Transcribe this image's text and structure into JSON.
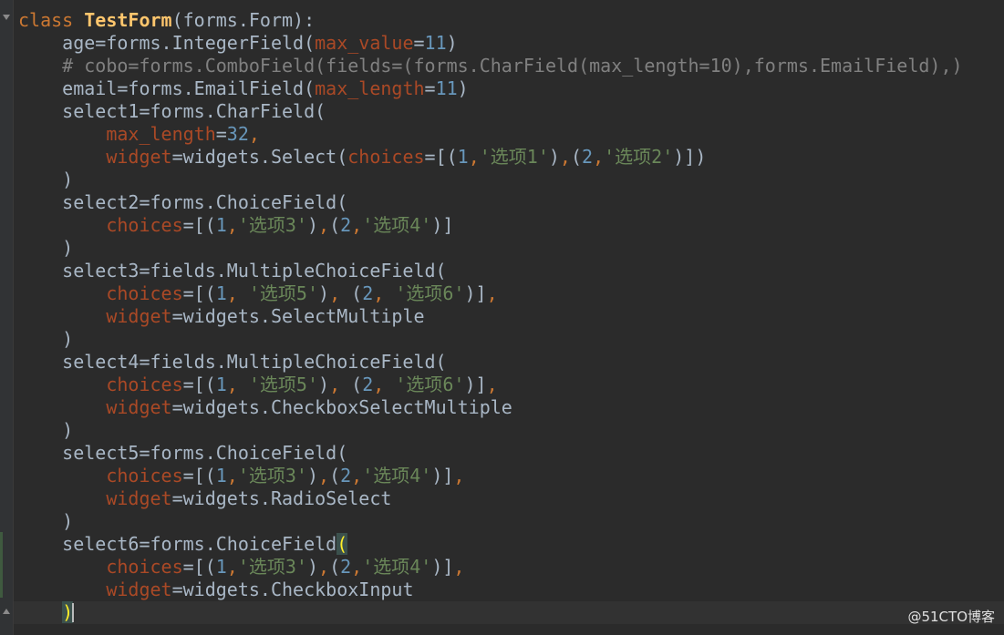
{
  "colors": {
    "background": "#2b2b2b",
    "keyword": "#cc7832",
    "class_name": "#ffc66d",
    "parameter": "#aa4926",
    "number": "#6897bb",
    "string": "#6a8759",
    "comment": "#808080",
    "text": "#a9b7c6"
  },
  "lines": [
    [
      {
        "t": "kw",
        "v": "class"
      },
      {
        "t": "tx",
        "v": " "
      },
      {
        "t": "cls",
        "v": "TestForm"
      },
      {
        "t": "tx",
        "v": "(forms.Form):"
      }
    ],
    [
      {
        "t": "tx",
        "v": "    age=forms.IntegerField("
      },
      {
        "t": "pr",
        "v": "max_value"
      },
      {
        "t": "tx",
        "v": "="
      },
      {
        "t": "nm",
        "v": "11"
      },
      {
        "t": "tx",
        "v": ")"
      }
    ],
    [
      {
        "t": "cm",
        "v": "    # cobo=forms.ComboField(fields=(forms.CharField(max_length=10),forms.EmailField),)"
      }
    ],
    [
      {
        "t": "tx",
        "v": "    email=forms.EmailField("
      },
      {
        "t": "pr",
        "v": "max_length"
      },
      {
        "t": "tx",
        "v": "="
      },
      {
        "t": "nm",
        "v": "11"
      },
      {
        "t": "tx",
        "v": ")"
      }
    ],
    [
      {
        "t": "tx",
        "v": "    select1=forms.CharField("
      }
    ],
    [
      {
        "t": "tx",
        "v": "        "
      },
      {
        "t": "pr",
        "v": "max_length"
      },
      {
        "t": "tx",
        "v": "="
      },
      {
        "t": "nm",
        "v": "32"
      },
      {
        "t": "pu",
        "v": ","
      }
    ],
    [
      {
        "t": "tx",
        "v": "        "
      },
      {
        "t": "pr",
        "v": "widget"
      },
      {
        "t": "tx",
        "v": "=widgets.Select("
      },
      {
        "t": "pr",
        "v": "choices"
      },
      {
        "t": "tx",
        "v": "=[("
      },
      {
        "t": "nm",
        "v": "1"
      },
      {
        "t": "pu",
        "v": ","
      },
      {
        "t": "st",
        "v": "'选项1'"
      },
      {
        "t": "tx",
        "v": ")"
      },
      {
        "t": "pu",
        "v": ","
      },
      {
        "t": "tx",
        "v": "("
      },
      {
        "t": "nm",
        "v": "2"
      },
      {
        "t": "pu",
        "v": ","
      },
      {
        "t": "st",
        "v": "'选项2'"
      },
      {
        "t": "tx",
        "v": ")])"
      }
    ],
    [
      {
        "t": "tx",
        "v": "    )"
      }
    ],
    [
      {
        "t": "tx",
        "v": "    select2=forms.ChoiceField("
      }
    ],
    [
      {
        "t": "tx",
        "v": "        "
      },
      {
        "t": "pr",
        "v": "choices"
      },
      {
        "t": "tx",
        "v": "=[("
      },
      {
        "t": "nm",
        "v": "1"
      },
      {
        "t": "pu",
        "v": ","
      },
      {
        "t": "st",
        "v": "'选项3'"
      },
      {
        "t": "tx",
        "v": ")"
      },
      {
        "t": "pu",
        "v": ","
      },
      {
        "t": "tx",
        "v": "("
      },
      {
        "t": "nm",
        "v": "2"
      },
      {
        "t": "pu",
        "v": ","
      },
      {
        "t": "st",
        "v": "'选项4'"
      },
      {
        "t": "tx",
        "v": ")]"
      }
    ],
    [
      {
        "t": "tx",
        "v": "    )"
      }
    ],
    [
      {
        "t": "tx",
        "v": "    select3=fields.MultipleChoiceField("
      }
    ],
    [
      {
        "t": "tx",
        "v": "        "
      },
      {
        "t": "pr",
        "v": "choices"
      },
      {
        "t": "tx",
        "v": "=[("
      },
      {
        "t": "nm",
        "v": "1"
      },
      {
        "t": "pu",
        "v": ", "
      },
      {
        "t": "st",
        "v": "'选项5'"
      },
      {
        "t": "tx",
        "v": ")"
      },
      {
        "t": "pu",
        "v": ", "
      },
      {
        "t": "tx",
        "v": "("
      },
      {
        "t": "nm",
        "v": "2"
      },
      {
        "t": "pu",
        "v": ", "
      },
      {
        "t": "st",
        "v": "'选项6'"
      },
      {
        "t": "tx",
        "v": ")]"
      },
      {
        "t": "pu",
        "v": ","
      }
    ],
    [
      {
        "t": "tx",
        "v": "        "
      },
      {
        "t": "pr",
        "v": "widget"
      },
      {
        "t": "tx",
        "v": "=widgets.SelectMultiple"
      }
    ],
    [
      {
        "t": "tx",
        "v": "    )"
      }
    ],
    [
      {
        "t": "tx",
        "v": "    select4=fields.MultipleChoiceField("
      }
    ],
    [
      {
        "t": "tx",
        "v": "        "
      },
      {
        "t": "pr",
        "v": "choices"
      },
      {
        "t": "tx",
        "v": "=[("
      },
      {
        "t": "nm",
        "v": "1"
      },
      {
        "t": "pu",
        "v": ", "
      },
      {
        "t": "st",
        "v": "'选项5'"
      },
      {
        "t": "tx",
        "v": ")"
      },
      {
        "t": "pu",
        "v": ", "
      },
      {
        "t": "tx",
        "v": "("
      },
      {
        "t": "nm",
        "v": "2"
      },
      {
        "t": "pu",
        "v": ", "
      },
      {
        "t": "st",
        "v": "'选项6'"
      },
      {
        "t": "tx",
        "v": ")]"
      },
      {
        "t": "pu",
        "v": ","
      }
    ],
    [
      {
        "t": "tx",
        "v": "        "
      },
      {
        "t": "pr",
        "v": "widget"
      },
      {
        "t": "tx",
        "v": "=widgets.CheckboxSelectMultiple"
      }
    ],
    [
      {
        "t": "tx",
        "v": "    )"
      }
    ],
    [
      {
        "t": "tx",
        "v": "    select5=forms.ChoiceField("
      }
    ],
    [
      {
        "t": "tx",
        "v": "        "
      },
      {
        "t": "pr",
        "v": "choices"
      },
      {
        "t": "tx",
        "v": "=[("
      },
      {
        "t": "nm",
        "v": "1"
      },
      {
        "t": "pu",
        "v": ","
      },
      {
        "t": "st",
        "v": "'选项3'"
      },
      {
        "t": "tx",
        "v": ")"
      },
      {
        "t": "pu",
        "v": ","
      },
      {
        "t": "tx",
        "v": "("
      },
      {
        "t": "nm",
        "v": "2"
      },
      {
        "t": "pu",
        "v": ","
      },
      {
        "t": "st",
        "v": "'选项4'"
      },
      {
        "t": "tx",
        "v": ")]"
      },
      {
        "t": "pu",
        "v": ","
      }
    ],
    [
      {
        "t": "tx",
        "v": "        "
      },
      {
        "t": "pr",
        "v": "widget"
      },
      {
        "t": "tx",
        "v": "=widgets.RadioSelect"
      }
    ],
    [
      {
        "t": "tx",
        "v": "    )"
      }
    ],
    [
      {
        "t": "tx",
        "v": "    select6=forms.ChoiceField"
      },
      {
        "t": "pm",
        "v": "("
      }
    ],
    [
      {
        "t": "tx",
        "v": "        "
      },
      {
        "t": "pr",
        "v": "choices"
      },
      {
        "t": "tx",
        "v": "=[("
      },
      {
        "t": "nm",
        "v": "1"
      },
      {
        "t": "pu",
        "v": ","
      },
      {
        "t": "st",
        "v": "'选项3'"
      },
      {
        "t": "tx",
        "v": ")"
      },
      {
        "t": "pu",
        "v": ","
      },
      {
        "t": "tx",
        "v": "("
      },
      {
        "t": "nm",
        "v": "2"
      },
      {
        "t": "pu",
        "v": ","
      },
      {
        "t": "st",
        "v": "'选项4'"
      },
      {
        "t": "tx",
        "v": ")]"
      },
      {
        "t": "pu",
        "v": ","
      }
    ],
    [
      {
        "t": "tx",
        "v": "        "
      },
      {
        "t": "pr",
        "v": "widget"
      },
      {
        "t": "tx",
        "v": "=widgets.CheckboxInput"
      }
    ],
    [
      {
        "t": "tx",
        "v": "    "
      },
      {
        "t": "pm",
        "v": ")"
      }
    ]
  ],
  "watermark": "@51CTO博客"
}
